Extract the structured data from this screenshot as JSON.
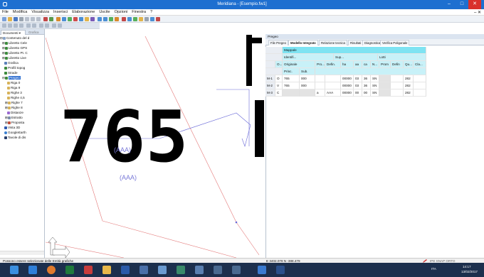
{
  "window": {
    "title": "Meridiana - [Esempio.fw1]"
  },
  "menu": [
    "File",
    "Modifica",
    "Visualizza",
    "Inserisci",
    "Elaborazione",
    "Uscite",
    "Opzioni",
    "Finestra",
    "?"
  ],
  "left_panel": {
    "tabs": [
      "Documenti",
      "Grafica"
    ],
    "tree": [
      "Contenuto del d",
      "Libretto Cele",
      "Libretto GPS",
      "Libretto Pt. C",
      "Libretto Live",
      "Grafica",
      "Profili topog",
      "Strade",
      "Pregeo",
      "Riga 0",
      "Riga 9",
      "Righe 3",
      "Righe 4,5",
      "Righe 7",
      "Righe 8",
      "Distanze",
      "Estratto",
      "Proposta",
      "Vista 3D",
      "GoogleEarth",
      "Tavole di dis"
    ]
  },
  "graphics": {
    "big_number": "765",
    "label_1": "(AAA)",
    "label_2": "(AAA)"
  },
  "right_panel": {
    "header": "Pregeo",
    "tabs": [
      "File Pregeo",
      "Modello Integrato",
      "Relazione tecnica",
      "Risultati",
      "Diagnostica",
      "Verifica Poligonale"
    ],
    "active_tab": "Modello Integrato",
    "grid": {
      "section_title": "Mappale",
      "group_headers": {
        "identifier": "Identifi...",
        "surface": "Sup...",
        "lots": "Lotti"
      },
      "columns": [
        "O...",
        "Originale",
        "Pro...",
        "Defin.",
        "ha",
        "aa",
        "ca",
        "N...",
        "Prom",
        "Defin",
        "Qu...",
        "Cla..."
      ],
      "sub_columns": [
        "Princ.",
        "Sub."
      ],
      "rows": [
        {
          "label": "M-1",
          "O": "O",
          "princ": "765",
          "sub": "000",
          "pro": "",
          "defin": "",
          "ha": "00000",
          "aa": "03",
          "ca": "36",
          "n": "SN",
          "prom": "",
          "defin2": "",
          "qu": "282",
          "cla": ""
        },
        {
          "label": "M-2",
          "O": "V",
          "princ": "765",
          "sub": "000",
          "pro": "",
          "defin": "",
          "ha": "00000",
          "aa": "03",
          "ca": "36",
          "n": "SN",
          "prom": "",
          "defin2": "",
          "qu": "282",
          "cla": ""
        },
        {
          "label": "M-3",
          "O": "C",
          "princ": "",
          "sub": "",
          "pro": "a",
          "defin": "AAA",
          "ha": "00000",
          "aa": "00",
          "ca": "00",
          "n": "SN",
          "prom": "",
          "defin2": "",
          "qu": "282",
          "cla": ""
        }
      ]
    }
  },
  "status": {
    "message": "Possono essere selezionate delle Entità grafiche",
    "coords": "E  3402.078  N  -388.479",
    "flags": "IPE  SNAP  ORTO"
  },
  "taskbar": {
    "tray_text": "ITA",
    "time": "14:17",
    "date": "13/02/2017"
  },
  "colors": {
    "title_bar": "#1e6fd0",
    "taskbar": "#1c2f4d",
    "grid_header": "#7fe3f2",
    "selection": "#2f6fd0",
    "drawing_red": "#e47a7a",
    "drawing_blue": "#6a6ad8"
  }
}
